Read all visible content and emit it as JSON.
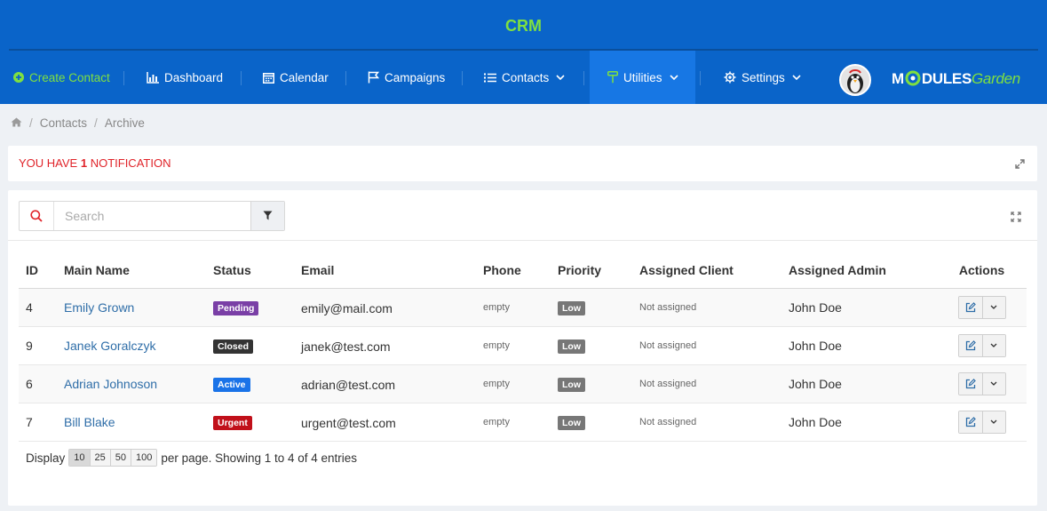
{
  "app": {
    "title": "CRM"
  },
  "nav": {
    "items": [
      {
        "label": "Create Contact",
        "icon": "plus-circle-icon"
      },
      {
        "label": "Dashboard",
        "icon": "bar-chart-icon"
      },
      {
        "label": "Calendar",
        "icon": "calendar-icon"
      },
      {
        "label": "Campaigns",
        "icon": "flag-icon"
      },
      {
        "label": "Contacts",
        "icon": "list-icon"
      },
      {
        "label": "Utilities",
        "icon": "paint-roller-icon"
      },
      {
        "label": "Settings",
        "icon": "gear-icon"
      }
    ],
    "active": "Utilities"
  },
  "brand": {
    "part1": "M",
    "part2": "DULES",
    "part3": "Garden"
  },
  "breadcrumb": {
    "home_icon": "home-icon",
    "items": [
      "Contacts",
      "Archive"
    ]
  },
  "notification": {
    "prefix": "YOU HAVE",
    "count": "1",
    "suffix": "NOTIFICATION"
  },
  "search": {
    "placeholder": "Search"
  },
  "table": {
    "headers": [
      "ID",
      "Main Name",
      "Status",
      "Email",
      "Phone",
      "Priority",
      "Assigned Client",
      "Assigned Admin",
      "Actions"
    ],
    "rows": [
      {
        "id": "4",
        "name": "Emily Grown",
        "status": "Pending",
        "status_color": "#7a3fa6",
        "email": "emily@mail.com",
        "phone": "empty",
        "priority": "Low",
        "client": "Not assigned",
        "admin": "John Doe"
      },
      {
        "id": "9",
        "name": "Janek Goralczyk",
        "status": "Closed",
        "status_color": "#333333",
        "email": "janek@test.com",
        "phone": "empty",
        "priority": "Low",
        "client": "Not assigned",
        "admin": "John Doe"
      },
      {
        "id": "6",
        "name": "Adrian Johnoson",
        "status": "Active",
        "status_color": "#1a73e8",
        "email": "adrian@test.com",
        "phone": "empty",
        "priority": "Low",
        "client": "Not assigned",
        "admin": "John Doe"
      },
      {
        "id": "7",
        "name": "Bill Blake",
        "status": "Urgent",
        "status_color": "#c1101a",
        "email": "urgent@test.com",
        "phone": "empty",
        "priority": "Low",
        "client": "Not assigned",
        "admin": "John Doe"
      }
    ]
  },
  "footer": {
    "display_label": "Display",
    "page_sizes": [
      "10",
      "25",
      "50",
      "100"
    ],
    "selected_page_size": "10",
    "summary": "per page. Showing 1 to 4 of 4 entries"
  },
  "colors": {
    "header": "#0a64c9",
    "accent_green": "#7fe040",
    "nav_active": "#1777e4",
    "notif_red": "#e0242a"
  }
}
